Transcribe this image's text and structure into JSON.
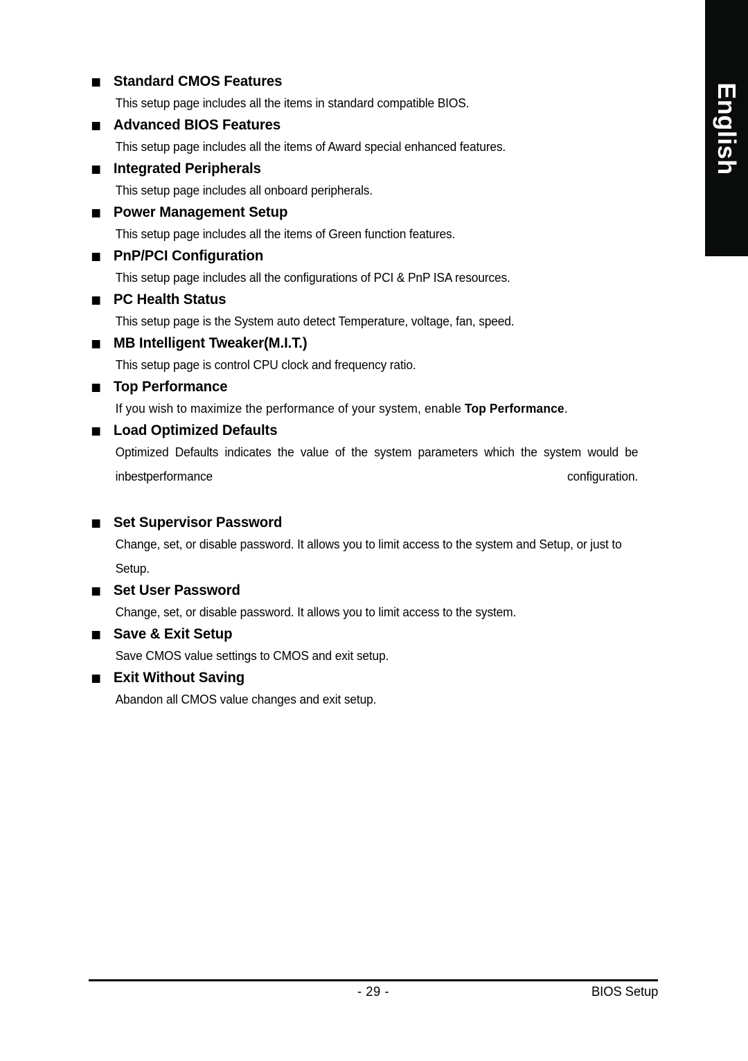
{
  "page": {
    "language_tab": "English",
    "background_color": "#ffffff",
    "tab_color": "#0a0c0c"
  },
  "sections": [
    {
      "heading": "Standard CMOS Features",
      "body": "This setup page includes all the items in standard compatible BIOS."
    },
    {
      "heading": "Advanced BIOS Features",
      "body": "This setup page includes all the items of Award special enhanced features."
    },
    {
      "heading": "Integrated Peripherals",
      "body": "This setup page includes all onboard peripherals."
    },
    {
      "heading": "Power Management Setup",
      "body": "This setup page includes all the items of Green function features."
    },
    {
      "heading": "PnP/PCI Configuration",
      "body": "This setup page includes all the configurations of PCI & PnP ISA resources."
    },
    {
      "heading": "PC Health Status",
      "body": "This setup page is the System auto detect Temperature, voltage, fan, speed."
    },
    {
      "heading": "MB Intelligent Tweaker(M.I.T.)",
      "body": "This setup page is control CPU clock and frequency ratio."
    },
    {
      "heading": "Top Performance",
      "body_before_bold": "If you wish to maximize the performance of your system, enable ",
      "body_bold": "Top Performance",
      "body_after_bold": "."
    },
    {
      "heading": "Load Optimized Defaults",
      "body_line1": "Optimized Defaults indicates the value of the system parameters which the system would be in",
      "body_line2_tight": "best",
      "body_line2_rest": "performance configuration."
    },
    {
      "heading": "Set Supervisor Password",
      "body": "Change, set, or disable password. It allows you to limit access to the system and Setup, or just to Setup."
    },
    {
      "heading": "Set User Password",
      "body": "Change, set, or disable password. It allows you to limit access to the system."
    },
    {
      "heading": "Save & Exit Setup",
      "body": "Save CMOS value settings to CMOS and exit setup."
    },
    {
      "heading": "Exit Without Saving",
      "body": "Abandon all CMOS value changes and exit setup."
    }
  ],
  "footer": {
    "page_number": "- 29 -",
    "section_label": "BIOS Setup"
  }
}
